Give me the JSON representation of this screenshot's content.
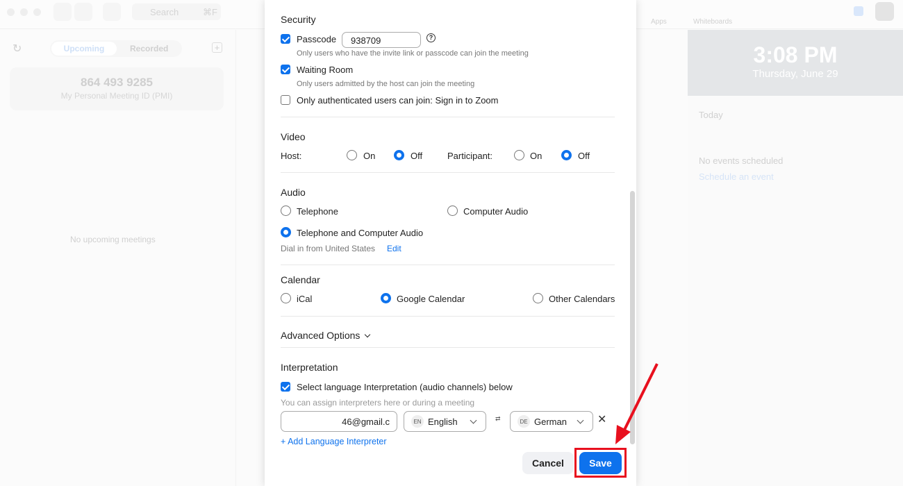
{
  "background": {
    "search_placeholder": "Search",
    "search_shortcut": "⌘F",
    "tabs": [
      "Upcoming",
      "Recorded"
    ],
    "pmi_number": "864 493 9285",
    "pmi_label": "My Personal Meeting ID (PMI)",
    "no_meetings": "No upcoming meetings",
    "nav": [
      "Apps",
      "Whiteboards"
    ],
    "time": "3:08 PM",
    "date": "Thursday, June 29",
    "today": "Today",
    "no_events": "No events scheduled",
    "schedule_link": "Schedule an event"
  },
  "security": {
    "title": "Security",
    "passcode_label": "Passcode",
    "passcode_checked": true,
    "passcode_value": "938709",
    "passcode_hint": "Only users who have the invite link or passcode can join the meeting",
    "waiting_room_label": "Waiting Room",
    "waiting_room_checked": true,
    "waiting_room_hint": "Only users admitted by the host can join the meeting",
    "auth_label": "Only authenticated users can join: Sign in to Zoom",
    "auth_checked": false
  },
  "video": {
    "title": "Video",
    "host_label": "Host:",
    "participant_label": "Participant:",
    "on": "On",
    "off": "Off",
    "host": "Off",
    "participant": "Off"
  },
  "audio": {
    "title": "Audio",
    "options": [
      "Telephone",
      "Computer Audio",
      "Telephone and Computer Audio"
    ],
    "selected": "Telephone and Computer Audio",
    "dial_in": "Dial in from United States",
    "edit": "Edit"
  },
  "calendar": {
    "title": "Calendar",
    "options": [
      "iCal",
      "Google Calendar",
      "Other Calendars"
    ],
    "selected": "Google Calendar"
  },
  "advanced": "Advanced Options",
  "interpretation": {
    "title": "Interpretation",
    "enable_label": "Select language Interpretation (audio channels) below",
    "enabled": true,
    "hint": "You can assign interpreters here or during a meeting",
    "email": "46@gmail.c",
    "from_code": "EN",
    "from": "English",
    "to_code": "DE",
    "to": "German",
    "add": "+ Add Language Interpreter"
  },
  "buttons": {
    "cancel": "Cancel",
    "save": "Save"
  },
  "colors": {
    "accent": "#0e72ed",
    "highlight": "#e8101e"
  }
}
